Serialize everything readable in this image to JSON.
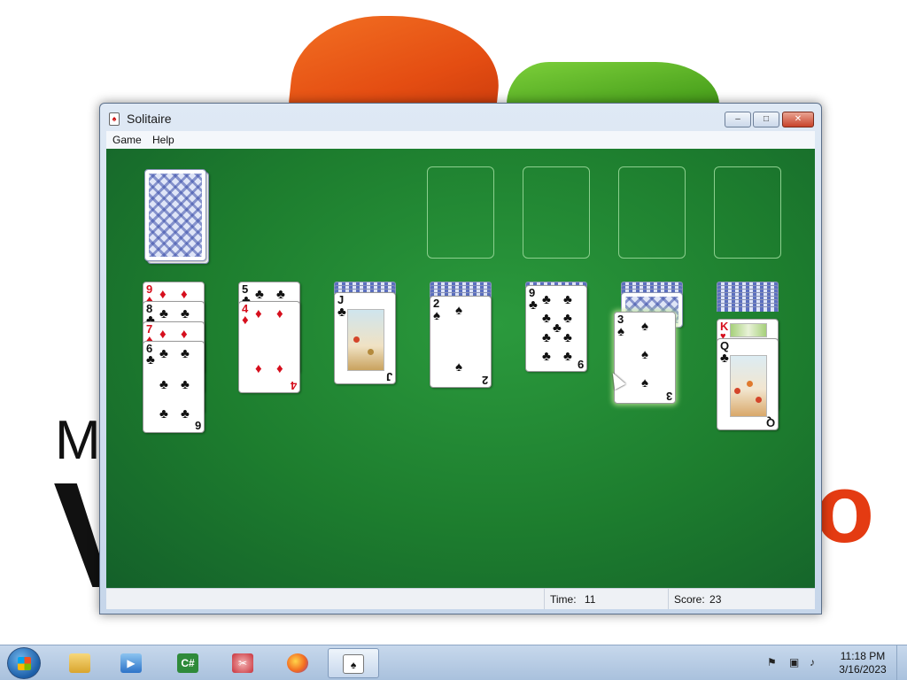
{
  "window": {
    "title": "Solitaire",
    "menu": [
      "Game",
      "Help"
    ],
    "controls": {
      "minimize": "–",
      "maximize": "□",
      "close": "✕"
    }
  },
  "board": {
    "stock": {
      "icon": "card-back-deck"
    },
    "foundations": [
      "empty",
      "empty",
      "empty",
      "empty"
    ],
    "tableau": [
      {
        "column": 1,
        "face_up": [
          {
            "rank": "9",
            "suit": "♦",
            "color": "red"
          },
          {
            "rank": "8",
            "suit": "♣",
            "color": "black"
          },
          {
            "rank": "7",
            "suit": "♦",
            "color": "red"
          },
          {
            "rank": "6",
            "suit": "♣",
            "color": "black"
          }
        ]
      },
      {
        "column": 2,
        "face_up": [
          {
            "rank": "5",
            "suit": "♣",
            "color": "black"
          },
          {
            "rank": "4",
            "suit": "♦",
            "color": "red"
          }
        ]
      },
      {
        "column": 3,
        "face_up": [
          {
            "rank": "J",
            "suit": "♣",
            "color": "black"
          }
        ]
      },
      {
        "column": 4,
        "face_up": [
          {
            "rank": "2",
            "suit": "♠",
            "color": "black"
          }
        ]
      },
      {
        "column": 5,
        "face_up": [
          {
            "rank": "9",
            "suit": "♣",
            "color": "black"
          }
        ]
      },
      {
        "column": 6,
        "face_up": [
          {
            "rank": "3",
            "suit": "♠",
            "color": "black"
          }
        ]
      },
      {
        "column": 7,
        "face_up": [
          {
            "rank": "K",
            "suit": "♥",
            "color": "red"
          },
          {
            "rank": "Q",
            "suit": "♣",
            "color": "black"
          }
        ]
      }
    ]
  },
  "status": {
    "time_label": "Time:",
    "time_value": "11",
    "score_label": "Score:",
    "score_value": "23"
  },
  "taskbar": {
    "apps": [
      "windows-explorer-icon",
      "media-player-icon",
      "csharp-icon",
      "snipping-tool-icon",
      "firefox-icon",
      "solitaire-icon"
    ],
    "active_app": "Solitaire",
    "clock_time": "11:18 PM",
    "clock_date": "3/16/2023"
  },
  "colors": {
    "felt": "#1d7d2e",
    "red_suit": "#d60f1d",
    "black_suit": "#111111"
  }
}
